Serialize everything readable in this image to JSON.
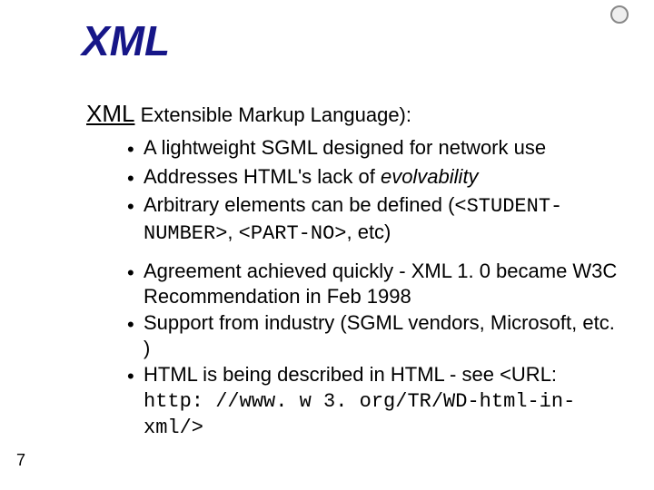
{
  "title": "XML",
  "subheading": {
    "acronym": "XML",
    "rest": " Extensible Markup Language):"
  },
  "group1": {
    "b1": "A lightweight SGML designed for network use",
    "b2_a": "Addresses HTML's lack of ",
    "b2_b": "evolvability",
    "b3_a": "Arbitrary elements can be defined (",
    "b3_b": "<STUDENT-NUMBER>",
    "b3_c": ", ",
    "b3_d": "<PART-NO>",
    "b3_e": ", etc)"
  },
  "group2": {
    "b1": "Agreement achieved quickly - XML 1. 0 became W3C Recommendation in Feb 1998",
    "b2": "Support from industry (SGML vendors, Microsoft, etc. )",
    "b3_a": "HTML is being described in HTML - see <URL: ",
    "b3_b": "http: //www. w 3. org/TR/WD-html-in-xml/",
    "b3_c": ">"
  },
  "pageNumber": "7",
  "bullet": "•"
}
